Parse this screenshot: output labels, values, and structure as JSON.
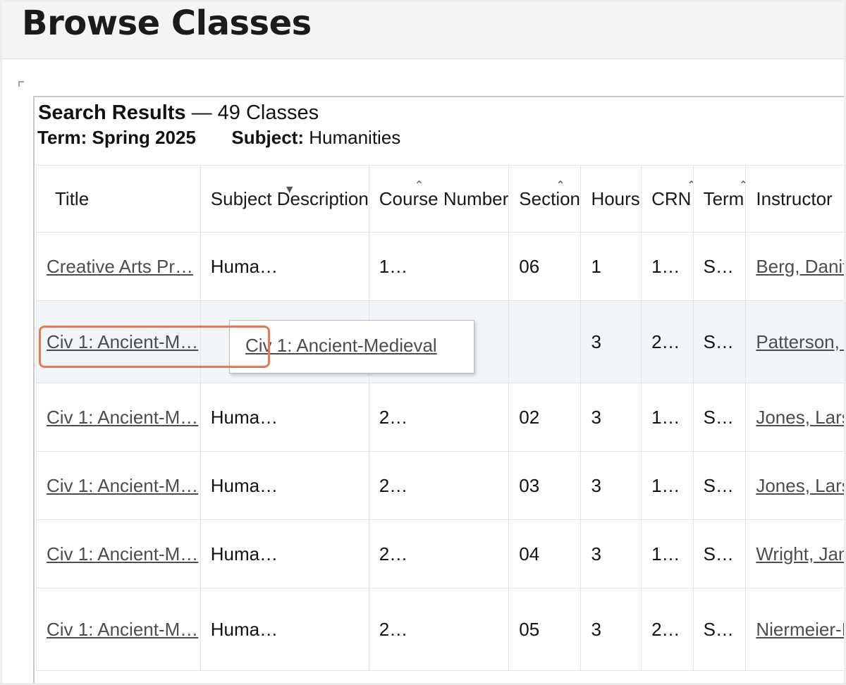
{
  "page": {
    "title": "Browse Classes"
  },
  "results": {
    "heading": "Search Results",
    "count_text": "— 49 Classes",
    "term_label": "Term:",
    "term_value": "Spring 2025",
    "subject_label": "Subject:",
    "subject_value": "Humanities"
  },
  "columns": [
    "Title",
    "Subject Description",
    "Course Number",
    "Section",
    "Hours",
    "CRN",
    "Term",
    "Instructor"
  ],
  "rows": [
    {
      "title": "Creative Arts Pr…",
      "subject": "Huma…",
      "course": "1…",
      "section": "06",
      "hours": "1",
      "crn": "1…",
      "term": "S…",
      "instructor": "Berg, Danit"
    },
    {
      "title": "Civ 1: Ancient-M…",
      "subject": "",
      "course": "",
      "section": "",
      "hours": "3",
      "crn": "2…",
      "term": "S…",
      "instructor": "Patterson, ("
    },
    {
      "title": "Civ 1: Ancient-M…",
      "subject": "Huma…",
      "course": "2…",
      "section": "02",
      "hours": "3",
      "crn": "1…",
      "term": "S…",
      "instructor": "Jones, Lars"
    },
    {
      "title": "Civ 1: Ancient-M…",
      "subject": "Huma…",
      "course": "2…",
      "section": "03",
      "hours": "3",
      "crn": "1…",
      "term": "S…",
      "instructor": "Jones, Lars"
    },
    {
      "title": "Civ 1: Ancient-M…",
      "subject": "Huma…",
      "course": "2…",
      "section": "04",
      "hours": "3",
      "crn": "1…",
      "term": "S…",
      "instructor": "Wright, Jan"
    },
    {
      "title": "Civ 1: Ancient-M…",
      "subject": "Huma…",
      "course": "2…",
      "section": "05",
      "hours": "3",
      "crn": "2…",
      "term": "S…",
      "instructor": "Niermeier-I"
    }
  ],
  "tooltip": {
    "text": "Civ 1: Ancient-Medieval"
  },
  "icons": {
    "sort": "sort-arrows-icon",
    "corner": "corner-bracket-icon"
  },
  "colors": {
    "link": "#4d4d4d",
    "focus_ring": "#e8784f",
    "highlight_row": "#f2f6fa"
  }
}
